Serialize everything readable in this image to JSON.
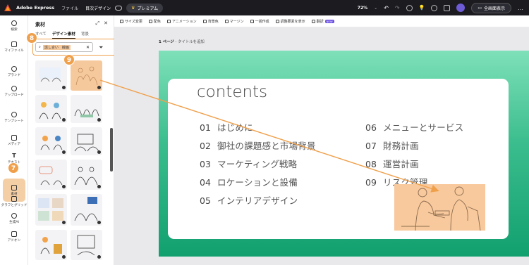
{
  "topbar": {
    "app_name": "Adobe Express",
    "file_menu": "ファイル",
    "doc_title": "目次デザイン",
    "premium_label": "プレミアム",
    "zoom": "72%",
    "present_label": "全画面表示"
  },
  "rail": {
    "items": [
      {
        "label": "検索",
        "icon": "search-icon"
      },
      {
        "label": "マイファイル",
        "icon": "folder-icon"
      },
      {
        "label": "ブランド",
        "icon": "brand-icon"
      },
      {
        "label": "アップロード",
        "icon": "upload-icon"
      },
      {
        "label": "テンプレート",
        "icon": "template-icon"
      },
      {
        "label": "メディア",
        "icon": "media-icon"
      },
      {
        "label": "テキスト",
        "icon": "text-icon"
      },
      {
        "label": "素材",
        "icon": "elements-icon"
      },
      {
        "label": "グラフとグリッド",
        "icon": "chart-icon"
      },
      {
        "label": "生成AI",
        "icon": "ai-icon"
      },
      {
        "label": "アドオン",
        "icon": "addon-icon"
      }
    ]
  },
  "panel": {
    "title": "素材",
    "tabs": [
      "すべて",
      "デザイン素材",
      "背景"
    ],
    "active_tab": "デザイン素材",
    "search_value": "話し合い　線画"
  },
  "canvas_toolbar": {
    "items": [
      "サイズ変更",
      "配色",
      "アニメーション",
      "背景色",
      "マージン",
      "一括作成",
      "調整要素を表示",
      "翻訳"
    ],
    "new_badge": "NEW"
  },
  "page": {
    "label_num": "1 ページ",
    "label_title": "- タイトルを追加"
  },
  "slide": {
    "heading": "contents",
    "toc": [
      {
        "num": "01",
        "text": "はじめに"
      },
      {
        "num": "02",
        "text": "御社の課題感と市場背景"
      },
      {
        "num": "03",
        "text": "マーケティング戦略"
      },
      {
        "num": "04",
        "text": "ロケーションと設備"
      },
      {
        "num": "05",
        "text": "インテリアデザイン"
      },
      {
        "num": "06",
        "text": "メニューとサービス"
      },
      {
        "num": "07",
        "text": "財務計画"
      },
      {
        "num": "08",
        "text": "運営計画"
      },
      {
        "num": "09",
        "text": "リスク管理"
      }
    ]
  },
  "annotations": {
    "step7": "7",
    "step8": "8",
    "step9": "9"
  },
  "colors": {
    "accent_orange": "#f0a04b",
    "highlight_peach": "#f6c99c",
    "slide_green_top": "#7ee0b8",
    "slide_green_bottom": "#12a06f",
    "topbar_bg": "#1b1b20"
  }
}
